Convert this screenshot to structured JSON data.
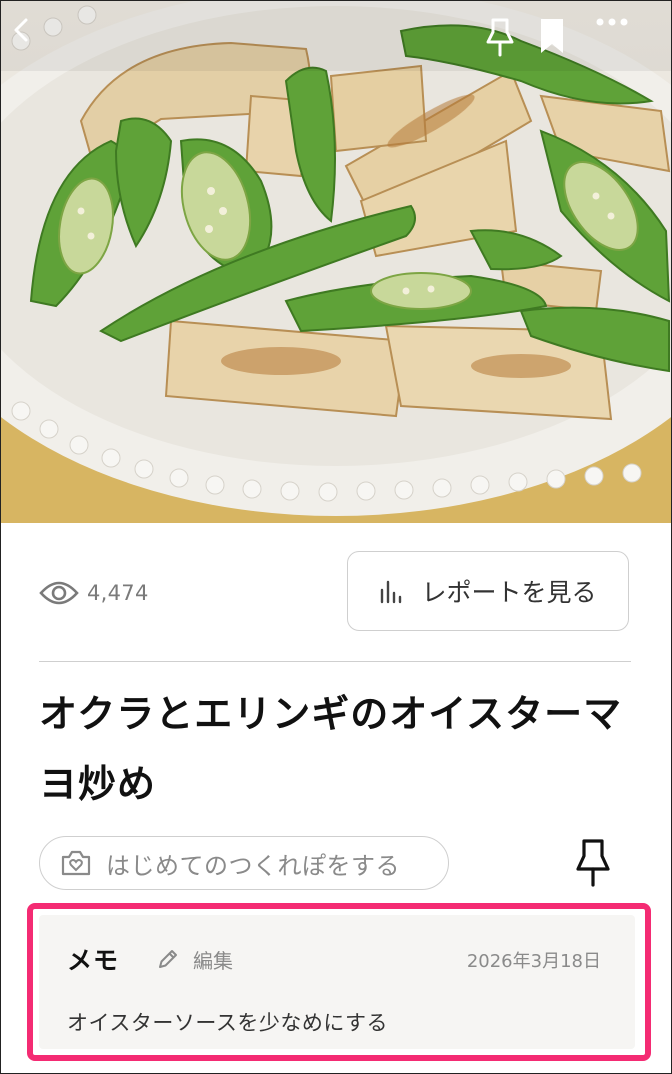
{
  "nav": {
    "back_icon": "chevron-left-icon",
    "pin_icon": "pin-icon",
    "bookmark_icon": "bookmark-icon",
    "more_icon": "more-horizontal-icon"
  },
  "hero": {
    "image": "stir-fried okra and king oyster mushrooms on a white plate"
  },
  "stats": {
    "view_icon": "eye-icon",
    "views": "4,474"
  },
  "report": {
    "icon": "bar-chart-icon",
    "label": "レポートを見る"
  },
  "recipe": {
    "title": "オクラとエリンギのオイスターマヨ炒め"
  },
  "first_tsukurepo": {
    "icon": "camera-heart-icon",
    "label": "はじめてのつくれぽをする"
  },
  "memo": {
    "heading": "メモ",
    "edit_icon": "pencil-icon",
    "edit_label": "編集",
    "date": "2026年3月18日",
    "text": "オイスターソースを少なめにする"
  },
  "colors": {
    "highlight": "#f42b73",
    "memo_background": "#f6f5f3",
    "muted_text": "#8a8a8a",
    "border": "#cfcfcf"
  }
}
